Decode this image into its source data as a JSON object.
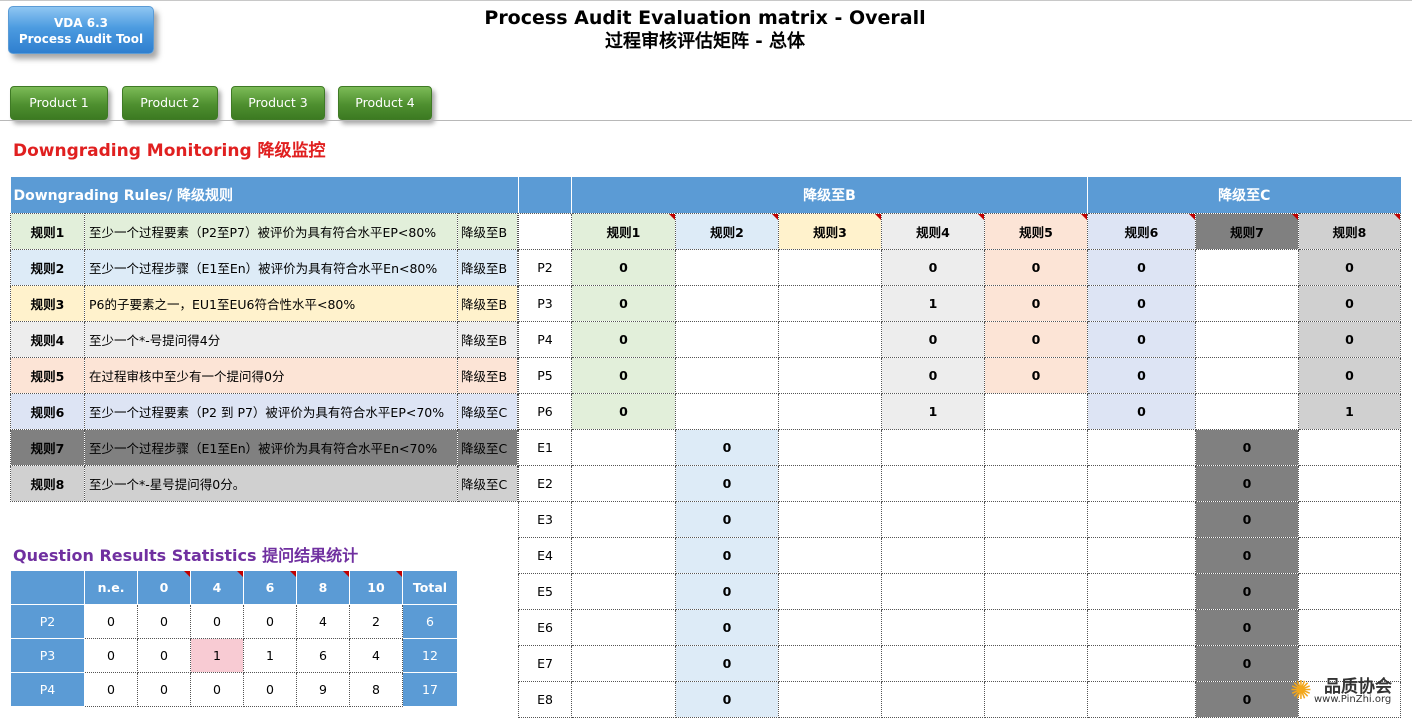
{
  "tool_button": {
    "line1": "VDA 6.3",
    "line2": "Process Audit Tool"
  },
  "title": {
    "en": "Process Audit Evaluation matrix - Overall",
    "zh": "过程审核评估矩阵 - 总体"
  },
  "product_tabs": [
    "Product 1",
    "Product 2",
    "Product 3",
    "Product 4"
  ],
  "downgrading": {
    "section_title": "Downgrading Monitoring 降级监控",
    "rules_header": "Downgrading Rules/  降级规则",
    "rules": [
      {
        "name": "规则1",
        "text": "至少一个过程要素（P2至P7）被评价为具有符合水平EP<80%",
        "down": "降级至B",
        "bg": "#e2efda"
      },
      {
        "name": "规则2",
        "text": "至少一个过程步骤（E1至En）被评价为具有符合水平En<80%",
        "down": "降级至B",
        "bg": "#ddebf7"
      },
      {
        "name": "规则3",
        "text": "P6的子要素之一，EU1至EU6符合性水平<80%",
        "down": "降级至B",
        "bg": "#fff2cc"
      },
      {
        "name": "规则4",
        "text": "至少一个*-号提问得4分",
        "down": "降级至B",
        "bg": "#ededed"
      },
      {
        "name": "规则5",
        "text": "在过程审核中至少有一个提问得0分",
        "down": "降级至B",
        "bg": "#fce4d6"
      },
      {
        "name": "规则6",
        "text": "至少一个过程要素（P2 到 P7）被评价为具有符合水平EP<70%",
        "down": "降级至C",
        "bg": "#dde4f4"
      },
      {
        "name": "规则7",
        "text": "至少一个过程步骤（E1至En）被评价为具有符合水平En<70%",
        "down": "降级至C",
        "bg": "#808080"
      },
      {
        "name": "规则8",
        "text": "至少一个*-星号提问得0分。",
        "down": "降级至C",
        "bg": "#d0d0d0"
      }
    ]
  },
  "matrix": {
    "group_b": "降级至B",
    "group_c": "降级至C",
    "columns": [
      "规则1",
      "规则2",
      "规则3",
      "规则4",
      "规则5",
      "规则6",
      "规则7",
      "规则8"
    ],
    "column_colors": [
      "#e2efda",
      "#ddebf7",
      "#fff2cc",
      "#ededed",
      "#fce4d6",
      "#dde4f4",
      "#808080",
      "#d0d0d0"
    ],
    "rows": [
      {
        "label": "P2",
        "cells": [
          "0",
          "",
          "",
          "0",
          "0",
          "0",
          "",
          "0"
        ]
      },
      {
        "label": "P3",
        "cells": [
          "0",
          "",
          "",
          "1",
          "0",
          "0",
          "",
          "0"
        ]
      },
      {
        "label": "P4",
        "cells": [
          "0",
          "",
          "",
          "0",
          "0",
          "0",
          "",
          "0"
        ]
      },
      {
        "label": "P5",
        "cells": [
          "0",
          "",
          "",
          "0",
          "0",
          "0",
          "",
          "0"
        ]
      },
      {
        "label": "P6",
        "cells": [
          "0",
          "",
          "",
          "1",
          "",
          "0",
          "",
          "1"
        ]
      },
      {
        "label": "E1",
        "cells": [
          "",
          "0",
          "",
          "",
          "",
          "",
          "0",
          ""
        ]
      },
      {
        "label": "E2",
        "cells": [
          "",
          "0",
          "",
          "",
          "",
          "",
          "0",
          ""
        ]
      },
      {
        "label": "E3",
        "cells": [
          "",
          "0",
          "",
          "",
          "",
          "",
          "0",
          ""
        ]
      },
      {
        "label": "E4",
        "cells": [
          "",
          "0",
          "",
          "",
          "",
          "",
          "0",
          ""
        ]
      },
      {
        "label": "E5",
        "cells": [
          "",
          "0",
          "",
          "",
          "",
          "",
          "0",
          ""
        ]
      },
      {
        "label": "E6",
        "cells": [
          "",
          "0",
          "",
          "",
          "",
          "",
          "0",
          ""
        ]
      },
      {
        "label": "E7",
        "cells": [
          "",
          "0",
          "",
          "",
          "",
          "",
          "0",
          ""
        ]
      },
      {
        "label": "E8",
        "cells": [
          "",
          "0",
          "",
          "",
          "",
          "",
          "0",
          ""
        ]
      }
    ]
  },
  "stats": {
    "section_title": "Question Results Statistics 提问结果统计",
    "headers": [
      "",
      "n.e.",
      "0",
      "4",
      "6",
      "8",
      "10",
      "Total"
    ],
    "rows": [
      {
        "label": "P2",
        "values": [
          "0",
          "0",
          "0",
          "0",
          "4",
          "2"
        ],
        "total": "6"
      },
      {
        "label": "P3",
        "values": [
          "0",
          "0",
          "1",
          "1",
          "6",
          "4"
        ],
        "total": "12"
      },
      {
        "label": "P4",
        "values": [
          "0",
          "0",
          "0",
          "0",
          "9",
          "8"
        ],
        "total": "17"
      }
    ],
    "highlight_color": "#f8cbd3"
  },
  "watermark": {
    "name": "品质协会",
    "url": "www.PinZhi.org",
    "logo": "sun-flower-icon"
  }
}
